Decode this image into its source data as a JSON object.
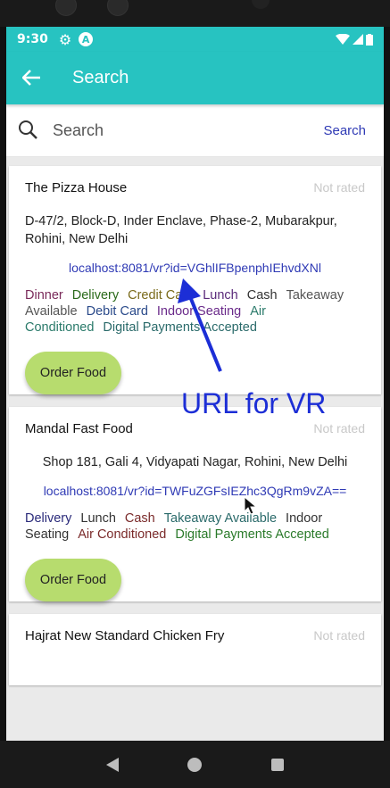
{
  "status": {
    "time": "9:30"
  },
  "appbar": {
    "title": "Search"
  },
  "search": {
    "placeholder": "Search",
    "button": "Search"
  },
  "restaurants": [
    {
      "name": "The Pizza House",
      "rating": "Not rated",
      "address": "D-47/2, Block-D, Inder Enclave, Phase-2, Mubarakpur, Rohini, New Delhi",
      "url": "localhost:8081/vr?id=VGhlIFBpenphIEhvdXNl",
      "tags": [
        {
          "label": "Dinner",
          "color": "#7a2a5a"
        },
        {
          "label": "Delivery",
          "color": "#2a6a1a"
        },
        {
          "label": "Credit Card",
          "color": "#7a6a1a"
        },
        {
          "label": "Lunch",
          "color": "#5a2a7a"
        },
        {
          "label": "Cash",
          "color": "#333333"
        },
        {
          "label": "Takeaway Available",
          "color": "#555555"
        },
        {
          "label": "Debit Card",
          "color": "#2a4a8a"
        },
        {
          "label": "Indoor Seating",
          "color": "#6a2a8a"
        },
        {
          "label": "Air Conditioned",
          "color": "#2a7a6a"
        },
        {
          "label": "Digital Payments Accepted",
          "color": "#2a6a6a"
        }
      ],
      "order_label": "Order Food"
    },
    {
      "name": "Mandal Fast Food",
      "rating": "Not rated",
      "address": "Shop 181, Gali 4, Vidyapati Nagar, Rohini, New Delhi",
      "url": "localhost:8081/vr?id=TWFuZGFsIEZhc3QgRm9vZA==",
      "tags": [
        {
          "label": "Delivery",
          "color": "#2a2a7a"
        },
        {
          "label": "Lunch",
          "color": "#333333"
        },
        {
          "label": "Cash",
          "color": "#7a2a2a"
        },
        {
          "label": "Takeaway Available",
          "color": "#2a6a6a"
        },
        {
          "label": "Indoor Seating",
          "color": "#333333"
        },
        {
          "label": "Air Conditioned",
          "color": "#7a2a2a"
        },
        {
          "label": "Digital Payments Accepted",
          "color": "#2a7a2a"
        }
      ],
      "order_label": "Order Food"
    },
    {
      "name": "Hajrat New Standard Chicken Fry",
      "rating": "Not rated"
    }
  ],
  "annotation": {
    "text": "URL for VR"
  },
  "colors": {
    "accent": "#27c3c1",
    "link": "#2f3ab5",
    "order_button": "#b7dc6e",
    "annotation": "#1c2ed6"
  }
}
